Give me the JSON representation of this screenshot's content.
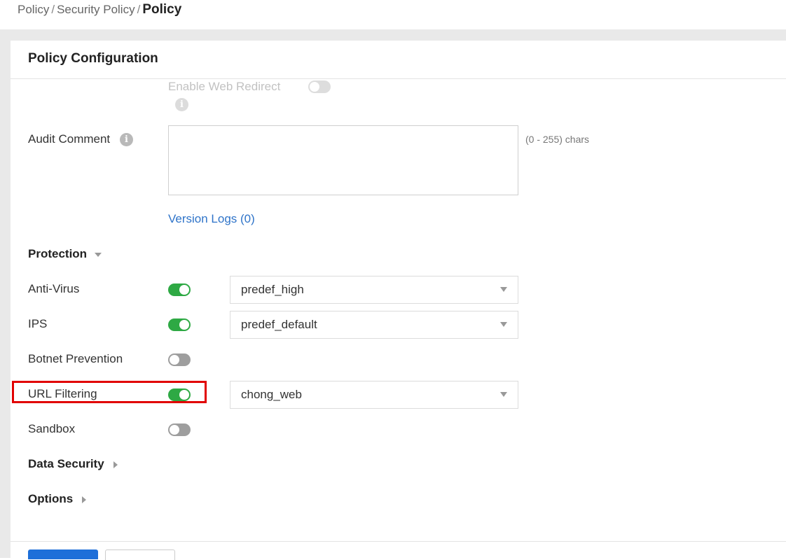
{
  "breadcrumb": {
    "items": [
      "Policy",
      "Security Policy"
    ],
    "current": "Policy",
    "separator": "/"
  },
  "panel": {
    "title": "Policy Configuration"
  },
  "web_redirect": {
    "label": "Enable Web Redirect",
    "enabled": false,
    "disabled": true
  },
  "audit_comment": {
    "label": "Audit Comment",
    "value": "",
    "hint": "(0 - 255) chars"
  },
  "version_logs": {
    "label": "Version Logs (0)"
  },
  "protection": {
    "label": "Protection",
    "expanded": true,
    "items": [
      {
        "label": "Anti-Virus",
        "enabled": true,
        "profile": "predef_high"
      },
      {
        "label": "IPS",
        "enabled": true,
        "profile": "predef_default"
      },
      {
        "label": "Botnet Prevention",
        "enabled": false
      },
      {
        "label": "URL Filtering",
        "enabled": true,
        "profile": "chong_web",
        "highlighted": true
      },
      {
        "label": "Sandbox",
        "enabled": false
      }
    ]
  },
  "data_security": {
    "label": "Data Security",
    "expanded": false
  },
  "options": {
    "label": "Options",
    "expanded": false
  },
  "colors": {
    "toggle_on": "#2ea944",
    "toggle_off": "#9e9e9e",
    "link": "#2f74c9",
    "highlight": "#e10000",
    "primary_button": "#1e6fd9"
  },
  "icons": [
    "info-icon",
    "caret-down-icon",
    "caret-right-icon"
  ]
}
